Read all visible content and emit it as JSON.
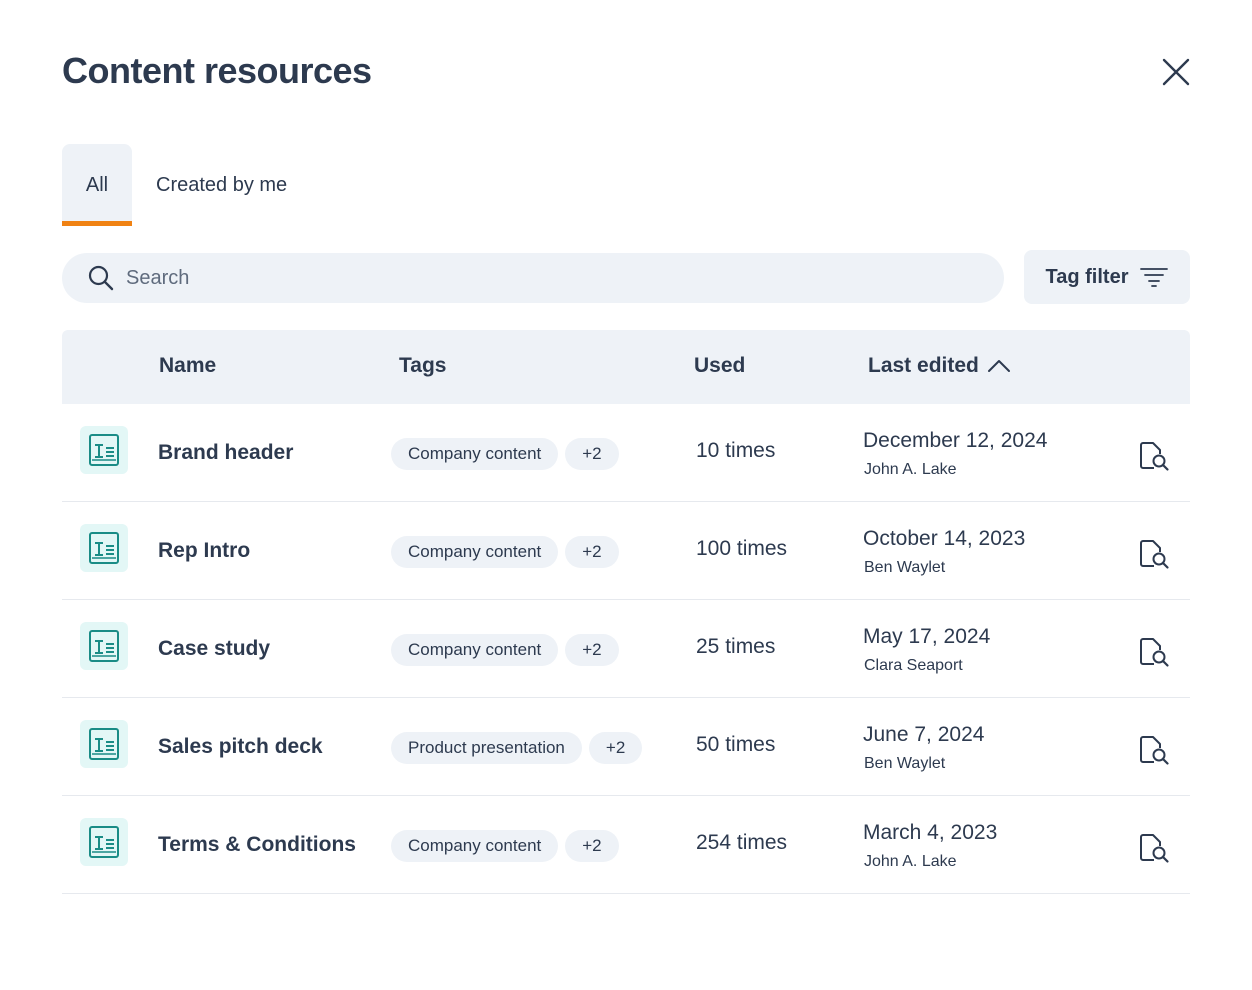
{
  "header": {
    "title": "Content resources",
    "close_icon": "close-icon"
  },
  "tabs": [
    {
      "label": "All",
      "active": true
    },
    {
      "label": "Created by me",
      "active": false
    }
  ],
  "search": {
    "placeholder": "Search",
    "value": "",
    "icon": "search-icon"
  },
  "tag_filter": {
    "label": "Tag filter",
    "icon": "filter-lines-icon"
  },
  "table": {
    "columns": {
      "name": "Name",
      "tags": "Tags",
      "used": "Used",
      "last_edited": "Last edited",
      "sort_icon": "chevron-up-icon"
    },
    "rows": [
      {
        "name": "Brand header",
        "tag": "Company content",
        "more_tags": "+2",
        "used": "10 times",
        "date": "December 12, 2024",
        "author": "John A. Lake"
      },
      {
        "name": "Rep Intro",
        "tag": "Company content",
        "more_tags": "+2",
        "used": "100 times",
        "date": "October 14, 2023",
        "author": "Ben Waylet"
      },
      {
        "name": "Case study",
        "tag": "Company content",
        "more_tags": "+2",
        "used": "25 times",
        "date": "May 17, 2024",
        "author": "Clara Seaport"
      },
      {
        "name": "Sales pitch deck",
        "tag": "Product presentation",
        "more_tags": "+2",
        "used": "50 times",
        "date": "June 7, 2024",
        "author": "Ben Waylet"
      },
      {
        "name": "Terms & Conditions",
        "tag": "Company content",
        "more_tags": "+2",
        "used": "254 times",
        "date": "March 4, 2023",
        "author": "John A. Lake"
      }
    ]
  },
  "colors": {
    "accent": "#f08213",
    "surface": "#eef2f7",
    "text": "#2d3a4f",
    "file_icon_bg": "#e3f7f6",
    "file_icon_stroke": "#1a8c86"
  }
}
